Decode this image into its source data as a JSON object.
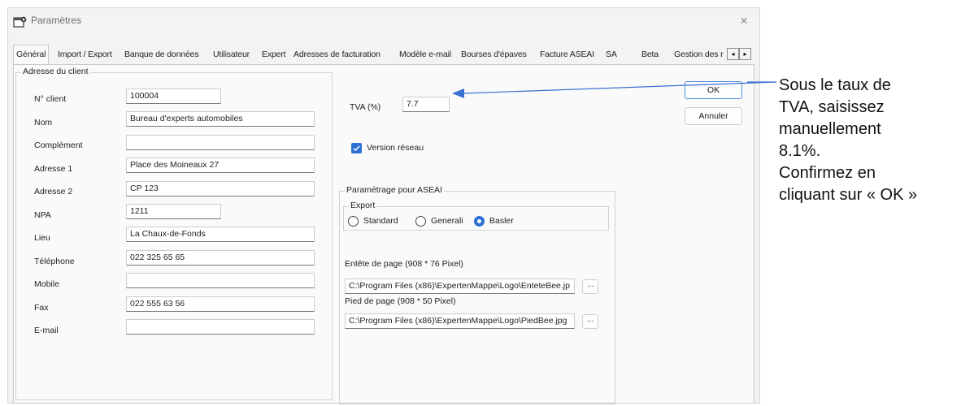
{
  "window": {
    "title": "Paramètres",
    "close_glyph": "×"
  },
  "tabs": [
    {
      "label": "Général"
    },
    {
      "label": "Import / Export"
    },
    {
      "label": "Banque de données"
    },
    {
      "label": "Utilisateur"
    },
    {
      "label": "Expert"
    },
    {
      "label": "Adresses de facturation"
    },
    {
      "label": "Modèle e-mail"
    },
    {
      "label": "Bourses d'épaves"
    },
    {
      "label": "Facture ASEAI"
    },
    {
      "label": "SA"
    },
    {
      "label": "Beta"
    },
    {
      "label": "Gestion des r"
    }
  ],
  "tab_scroll": {
    "left": "◂",
    "right": "▸"
  },
  "client": {
    "legend": "Adresse du client",
    "fields": [
      {
        "label": "N° client",
        "value": "100004"
      },
      {
        "label": "Nom",
        "value": "Bureau d'experts automobiles"
      },
      {
        "label": "Complément",
        "value": ""
      },
      {
        "label": "Adresse 1",
        "value": "Place des Moineaux 27"
      },
      {
        "label": "Adresse 2",
        "value": "CP 123"
      },
      {
        "label": "NPA",
        "value": "1211"
      },
      {
        "label": "Lieu",
        "value": "La Chaux-de-Fonds"
      },
      {
        "label": "Téléphone",
        "value": "022 325 65 65"
      },
      {
        "label": "Mobile",
        "value": ""
      },
      {
        "label": "Fax",
        "value": "022 555 63 56"
      },
      {
        "label": "E-mail",
        "value": ""
      }
    ]
  },
  "tva": {
    "label": "TVA (%)",
    "value": "7.7"
  },
  "network": {
    "label": "Version réseau",
    "checked": true
  },
  "aseai": {
    "legend": "Paramétrage pour ASEAI",
    "export_legend": "Export",
    "options": [
      {
        "label": "Standard",
        "selected": false
      },
      {
        "label": "Generali",
        "selected": false
      },
      {
        "label": "Basler",
        "selected": true
      }
    ],
    "header_label": "Entête de page (908 * 76 Pixel)",
    "header_path": "C:\\Program Files (x86)\\ExpertenMappe\\Logo\\EnteteBee.jp",
    "footer_label": "Pied de page (908 * 50 Pixel)",
    "footer_path": "C:\\Program Files (x86)\\ExpertenMappe\\Logo\\PiedBee.jpg",
    "browse_label": "..."
  },
  "buttons": {
    "ok": "OK",
    "cancel": "Annuler"
  },
  "annotation": {
    "lines": [
      "Sous le taux de",
      "TVA, saisissez",
      "manuellement",
      "8.1%.",
      "Confirmez en",
      "cliquant sur « OK »"
    ]
  },
  "colors": {
    "accent": "#2f6fd3",
    "arrow": "#3b6fd0"
  }
}
